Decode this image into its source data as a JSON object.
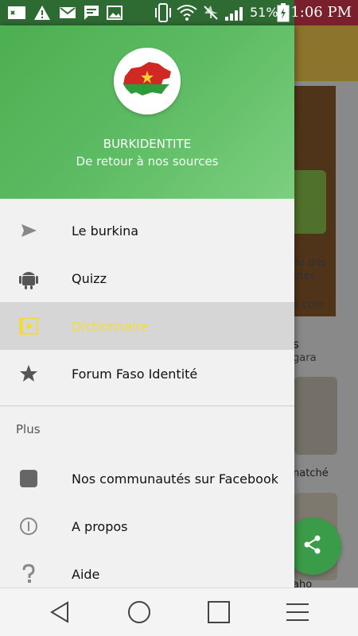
{
  "status_bar": {
    "battery_percent": "51%",
    "time": "1:06 PM",
    "icons": [
      "keyboard-icon",
      "warning-icon",
      "gmail-icon",
      "message-icon",
      "image-icon",
      "vibrate-icon",
      "wifi-icon",
      "airplane-off-icon",
      "signal-icon",
      "battery-charging-icon"
    ]
  },
  "drawer": {
    "header": {
      "app_name": "BURKIDENTITE",
      "slogan": "De retour à nos sources"
    },
    "items": [
      {
        "label": "Le burkina",
        "icon": "send-icon"
      },
      {
        "label": "Quizz",
        "icon": "android-icon"
      },
      {
        "label": "Dictionnaire",
        "icon": "video-icon",
        "active": true
      },
      {
        "label": "Forum Faso Identité",
        "icon": "star-icon"
      }
    ],
    "section_title": "Plus",
    "more_items": [
      {
        "label": "Nos communautés sur Facebook",
        "icon": "square-icon"
      },
      {
        "label": "A propos",
        "icon": "info-icon"
      },
      {
        "label": "Aide",
        "icon": "help-icon"
      }
    ]
  },
  "background": {
    "texts": [
      "lle des",
      "utés",
      "e.com",
      "s",
      "gara",
      "natché",
      "aho"
    ]
  },
  "colors": {
    "header_green": "#4caf50",
    "active_text": "#f2dc3d",
    "fab_green": "#3a9b48"
  }
}
